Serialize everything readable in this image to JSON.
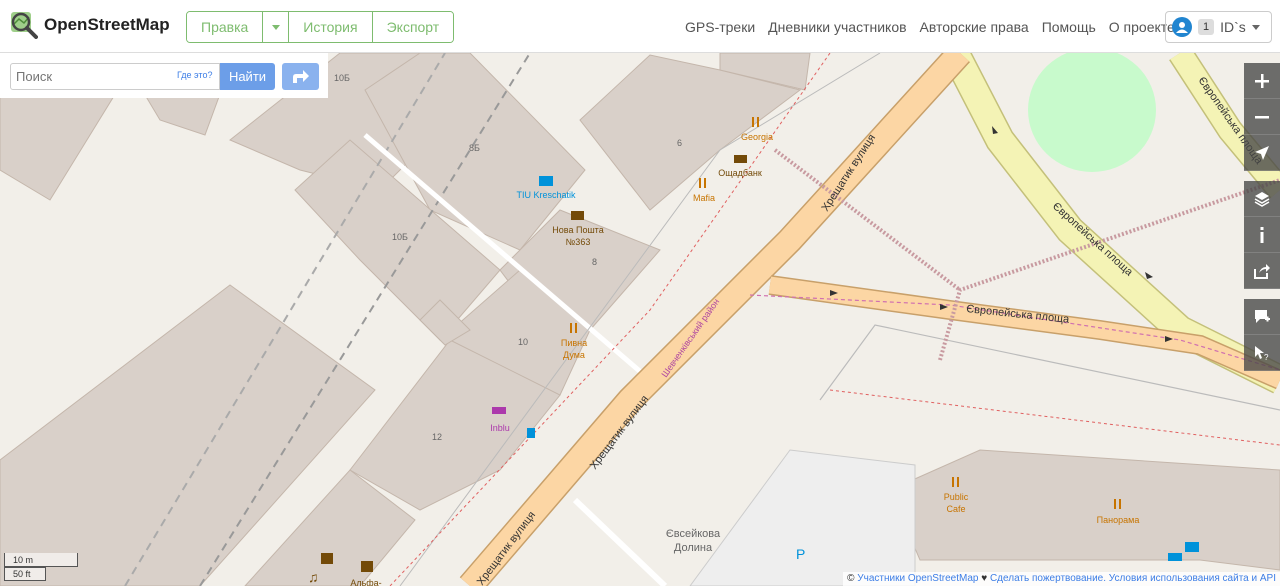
{
  "header": {
    "logo_text": "OpenStreetMap",
    "edit_label": "Правка",
    "history_label": "История",
    "export_label": "Экспорт",
    "nav": {
      "gps": "GPS-треки",
      "diaries": "Дневники участников",
      "copyright": "Авторские права",
      "help": "Помощь",
      "about": "О проекте"
    },
    "user": {
      "badge": "1",
      "name": "ID`s"
    }
  },
  "search": {
    "placeholder": "Поиск",
    "where_label": "Где это?",
    "go_label": "Найти"
  },
  "map": {
    "labels": {
      "b10b_top": "10Б",
      "b8b": "8Б",
      "b6": "6",
      "georgia": "Georgia",
      "oschadbank": "Ощадбанк",
      "mafia": "Mafia",
      "tiu": "TIU Kreschatik",
      "nova_poshta": "Нова Пошта",
      "nova_poshta_num": "№363",
      "b10b": "10Б",
      "b8": "8",
      "b10": "10",
      "pyvna1": "Пивна",
      "pyvna2": "Дума",
      "inblu": "Inblu",
      "b12": "12",
      "street_khreshchatyk1": "Хрещатик вулиця",
      "street_khreshchatyk2": "Хрещатик вулиця",
      "street_khreshchatyk3": "Хрещатик вулиця",
      "district": "Шевченківський район",
      "square1": "Європейська площа",
      "square2": "Європейська площа",
      "square3": "Європейська площа",
      "public_cafe1": "Public",
      "public_cafe2": "Cafe",
      "panorama": "Панорама",
      "yevseieva1": "Євсейкова",
      "yevseieva2": "Долина",
      "parking": "P",
      "alfa": "Альфа-"
    }
  },
  "scale": {
    "metric": "10 m",
    "imperial": "50 ft"
  },
  "attribution": {
    "copy": "©",
    "contributors": "Участники OpenStreetMap",
    "heart": "♥",
    "donate": "Сделать пожертвование.",
    "terms": "Условия использования сайта и API"
  },
  "colors": {
    "brand_green": "#7ebc6f",
    "primary_road": "#fcd6a4",
    "road_casing": "#c8a06a",
    "building": "#d9d0c9",
    "building_border": "#c4b6ab",
    "park": "#c8facc",
    "pedestrian": "#f4f3b5",
    "search_button": "#6c9ee8",
    "control_bg": "#464646"
  }
}
